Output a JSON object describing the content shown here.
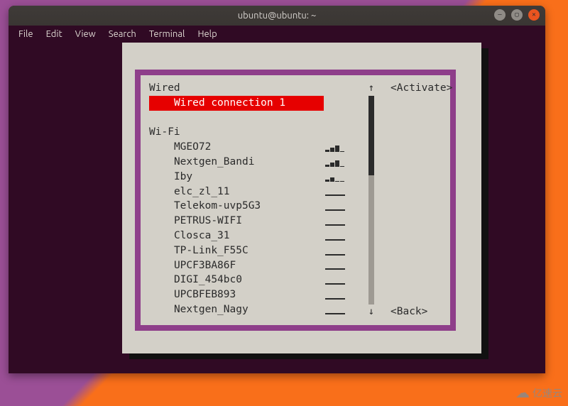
{
  "window": {
    "title": "ubuntu@ubuntu: ~"
  },
  "menubar": {
    "items": [
      "File",
      "Edit",
      "View",
      "Search",
      "Terminal",
      "Help"
    ]
  },
  "nmtui": {
    "sections": {
      "wired": {
        "header": "Wired",
        "items": [
          {
            "label": "Wired connection 1",
            "selected": true
          }
        ]
      },
      "wifi": {
        "header": "Wi-Fi",
        "items": [
          {
            "label": "MGEO72",
            "signal": 3
          },
          {
            "label": "Nextgen_Bandi",
            "signal": 3
          },
          {
            "label": "Iby",
            "signal": 2
          },
          {
            "label": "elc_zl_11",
            "signal": 1
          },
          {
            "label": "Telekom-uvp5G3",
            "signal": 1
          },
          {
            "label": "PETRUS-WIFI",
            "signal": 1
          },
          {
            "label": "Closca_31",
            "signal": 1
          },
          {
            "label": "TP-Link_F55C",
            "signal": 1
          },
          {
            "label": "UPCF3BA86F",
            "signal": 1
          },
          {
            "label": "DIGI_454bc0",
            "signal": 1
          },
          {
            "label": "UPCBFEB893",
            "signal": 1
          },
          {
            "label": "Nextgen_Nagy",
            "signal": 1
          }
        ]
      }
    },
    "buttons": {
      "activate": "<Activate>",
      "back": "<Back>"
    },
    "scroll": {
      "up": "↑",
      "down": "↓"
    }
  },
  "watermark": {
    "icon": "☁",
    "text": "亿速云"
  }
}
